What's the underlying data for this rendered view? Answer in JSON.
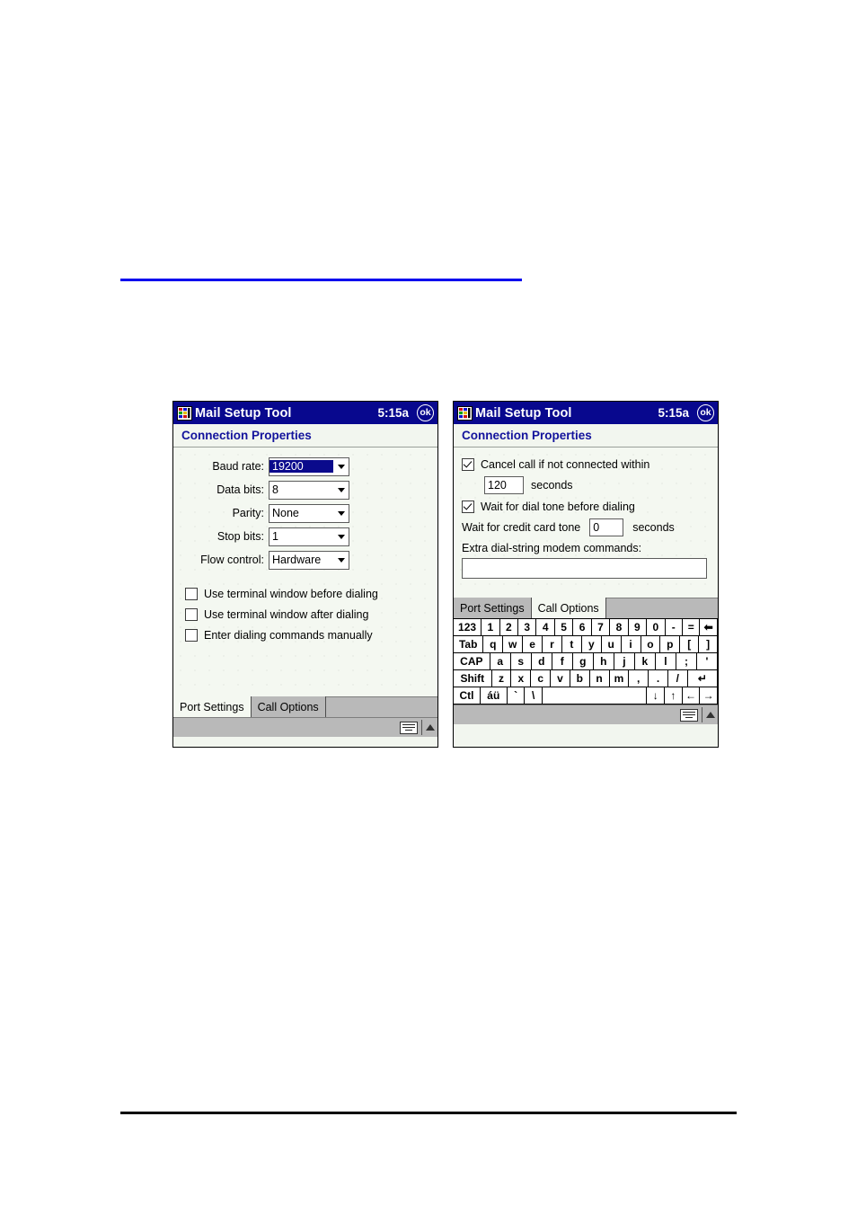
{
  "page": {
    "blue_rule": "horizontal-blue-rule",
    "black_rule": "horizontal-black-rule"
  },
  "panels": [
    {
      "id": "port-settings-panel",
      "titlebar": {
        "icon": "mail-setup-tool-icon",
        "title": "Mail Setup Tool",
        "time": "5:15a",
        "ok_label": "ok"
      },
      "subtitle": "Connection Properties",
      "fields": [
        {
          "label": "Baud rate:",
          "value": "19200",
          "selected": true
        },
        {
          "label": "Data bits:",
          "value": "8",
          "selected": false
        },
        {
          "label": "Parity:",
          "value": "None",
          "selected": false
        },
        {
          "label": "Stop bits:",
          "value": "1",
          "selected": false
        },
        {
          "label": "Flow control:",
          "value": "Hardware",
          "selected": false
        }
      ],
      "checkboxes": [
        {
          "label": "Use terminal window before dialing",
          "checked": false
        },
        {
          "label": "Use terminal window after dialing",
          "checked": false
        },
        {
          "label": "Enter dialing commands manually",
          "checked": false
        }
      ],
      "tabs": [
        {
          "label": "Port Settings",
          "active": true
        },
        {
          "label": "Call Options",
          "active": false
        }
      ]
    },
    {
      "id": "call-options-panel",
      "titlebar": {
        "icon": "mail-setup-tool-icon",
        "title": "Mail Setup Tool",
        "time": "5:15a",
        "ok_label": "ok"
      },
      "subtitle": "Connection Properties",
      "cancel_call": {
        "checkbox_label": "Cancel call if not connected within",
        "checked": true,
        "seconds_value": "120",
        "seconds_label": "seconds"
      },
      "dial_tone": {
        "checkbox_label": "Wait for dial tone before dialing",
        "checked": true
      },
      "credit_card_tone": {
        "prefix_label": "Wait for credit card tone",
        "value": "0",
        "suffix_label": "seconds"
      },
      "extra_commands": {
        "label": "Extra dial-string modem commands:",
        "value": ""
      },
      "tabs": [
        {
          "label": "Port Settings",
          "active": false
        },
        {
          "label": "Call Options",
          "active": true
        }
      ],
      "keyboard": {
        "rows": [
          [
            "123",
            "1",
            "2",
            "3",
            "4",
            "5",
            "6",
            "7",
            "8",
            "9",
            "0",
            "-",
            "=",
            "⬅"
          ],
          [
            "Tab",
            "q",
            "w",
            "e",
            "r",
            "t",
            "y",
            "u",
            "i",
            "o",
            "p",
            "[",
            "]"
          ],
          [
            "CAP",
            "a",
            "s",
            "d",
            "f",
            "g",
            "h",
            "j",
            "k",
            "l",
            ";",
            "'"
          ],
          [
            "Shift",
            "z",
            "x",
            "c",
            "v",
            "b",
            "n",
            "m",
            ",",
            ".",
            "/",
            "↵"
          ],
          [
            "Ctl",
            "áü",
            "`",
            "\\",
            "",
            "↓",
            "↑",
            "←",
            "→"
          ]
        ]
      }
    }
  ],
  "statusbar": {
    "keyboard_icon": "soft-keyboard-icon",
    "arrow_icon": "chevron-up-icon"
  },
  "colors": {
    "titlebar": "#08088e",
    "subtitle_text": "#13139c",
    "selection": "#0a0a8c",
    "client_bg": "#f4f8f1",
    "chrome_gray": "#b9b9b9",
    "blue_rule": "#0000ee"
  }
}
